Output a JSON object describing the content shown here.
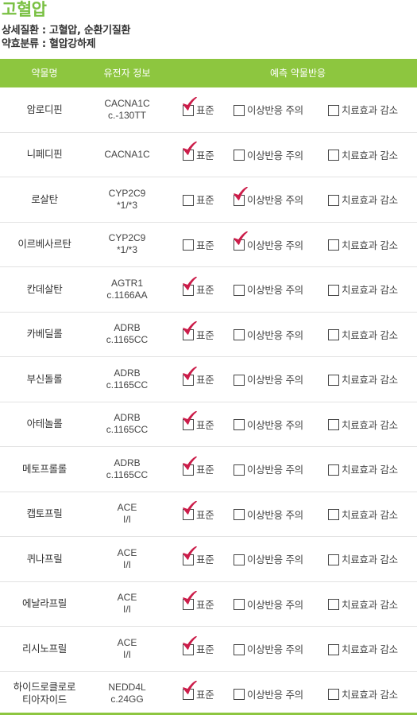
{
  "title": "고혈압",
  "detail_disease": "상세질환 : 고혈압, 순환기질환",
  "drug_class": "약효분류 : 혈압강하제",
  "headers": {
    "drug": "약물명",
    "gene": "유전자 정보",
    "prediction": "예측 약물반응"
  },
  "options": {
    "standard": "표준",
    "caution": "이상반응 주의",
    "reduced": "치료효과 감소"
  },
  "colors": {
    "accent": "#8dc63f",
    "check": "#cc1d4a"
  },
  "icons": {
    "check": "check-mark-icon"
  },
  "rows": [
    {
      "drug": "암로디핀",
      "gene": "CACNA1C",
      "variant": "c.-130TT",
      "selected": "standard"
    },
    {
      "drug": "니페디핀",
      "gene": "CACNA1C",
      "variant": "",
      "selected": "standard"
    },
    {
      "drug": "로살탄",
      "gene": "CYP2C9",
      "variant": "*1/*3",
      "selected": "caution"
    },
    {
      "drug": "이르베사르탄",
      "gene": "CYP2C9",
      "variant": "*1/*3",
      "selected": "caution"
    },
    {
      "drug": "칸데살탄",
      "gene": "AGTR1",
      "variant": "c.1166AA",
      "selected": "standard"
    },
    {
      "drug": "카베딜롤",
      "gene": "ADRB",
      "variant": "c.1165CC",
      "selected": "standard"
    },
    {
      "drug": "부신돌롤",
      "gene": "ADRB",
      "variant": "c.1165CC",
      "selected": "standard"
    },
    {
      "drug": "아테놀롤",
      "gene": "ADRB",
      "variant": "c.1165CC",
      "selected": "standard"
    },
    {
      "drug": "메토프롤롤",
      "gene": "ADRB",
      "variant": "c.1165CC",
      "selected": "standard"
    },
    {
      "drug": "캡토프릴",
      "gene": "ACE",
      "variant": "I/I",
      "selected": "standard"
    },
    {
      "drug": "퀴나프릴",
      "gene": "ACE",
      "variant": "I/I",
      "selected": "standard"
    },
    {
      "drug": "에날라프릴",
      "gene": "ACE",
      "variant": "I/I",
      "selected": "standard"
    },
    {
      "drug": "리시노프릴",
      "gene": "ACE",
      "variant": "I/I",
      "selected": "standard"
    },
    {
      "drug": "하이드로클로로\n티아자이드",
      "gene": "NEDD4L",
      "variant": "c.24GG",
      "selected": "standard"
    }
  ]
}
